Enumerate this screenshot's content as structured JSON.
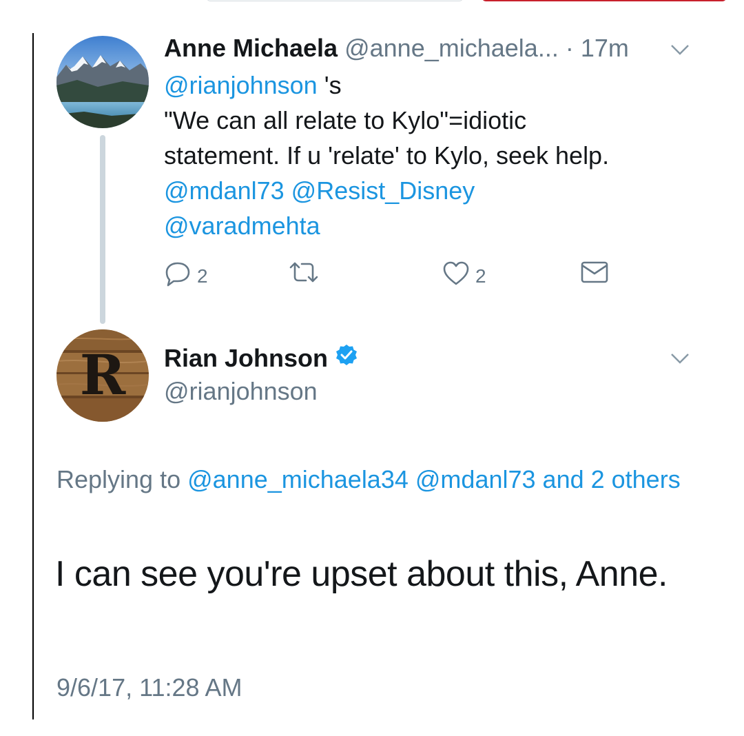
{
  "colors": {
    "link": "#1b95e0",
    "muted": "#657786",
    "text": "#14171a",
    "thread_line": "#ccd6dd",
    "verified": "#1da1f2"
  },
  "original_tweet": {
    "author_name": "Anne Michaela",
    "author_handle": "@anne_michaela...",
    "separator": "·",
    "time": "17m",
    "body": {
      "mention_1": "@rianjohnson",
      "suffix_1": " 's",
      "line_2": "\"We can all relate to Kylo\"=idiotic",
      "line_3": "statement. If u 'relate' to Kylo, seek help.",
      "mention_2": "@mdanl73",
      "mention_3": "@Resist_Disney",
      "mention_4": "@varadmehta"
    },
    "actions": {
      "reply_count": "2",
      "like_count": "2"
    },
    "icons": [
      "reply-icon",
      "retweet-icon",
      "like-icon",
      "direct-message-icon",
      "chevron-down-icon"
    ]
  },
  "reply_tweet": {
    "author_name": "Rian Johnson",
    "author_handle": "@rianjohnson",
    "avatar_letter": "R",
    "replying_prefix": "Replying to ",
    "replying_mention_1": "@anne_michaela34",
    "replying_mention_2": "@mdanl73",
    "replying_suffix": "and 2 others",
    "text": "I can see you're upset about this, Anne.",
    "timestamp": "9/6/17, 11:28 AM",
    "icons": [
      "verified-badge-icon",
      "chevron-down-icon"
    ]
  }
}
